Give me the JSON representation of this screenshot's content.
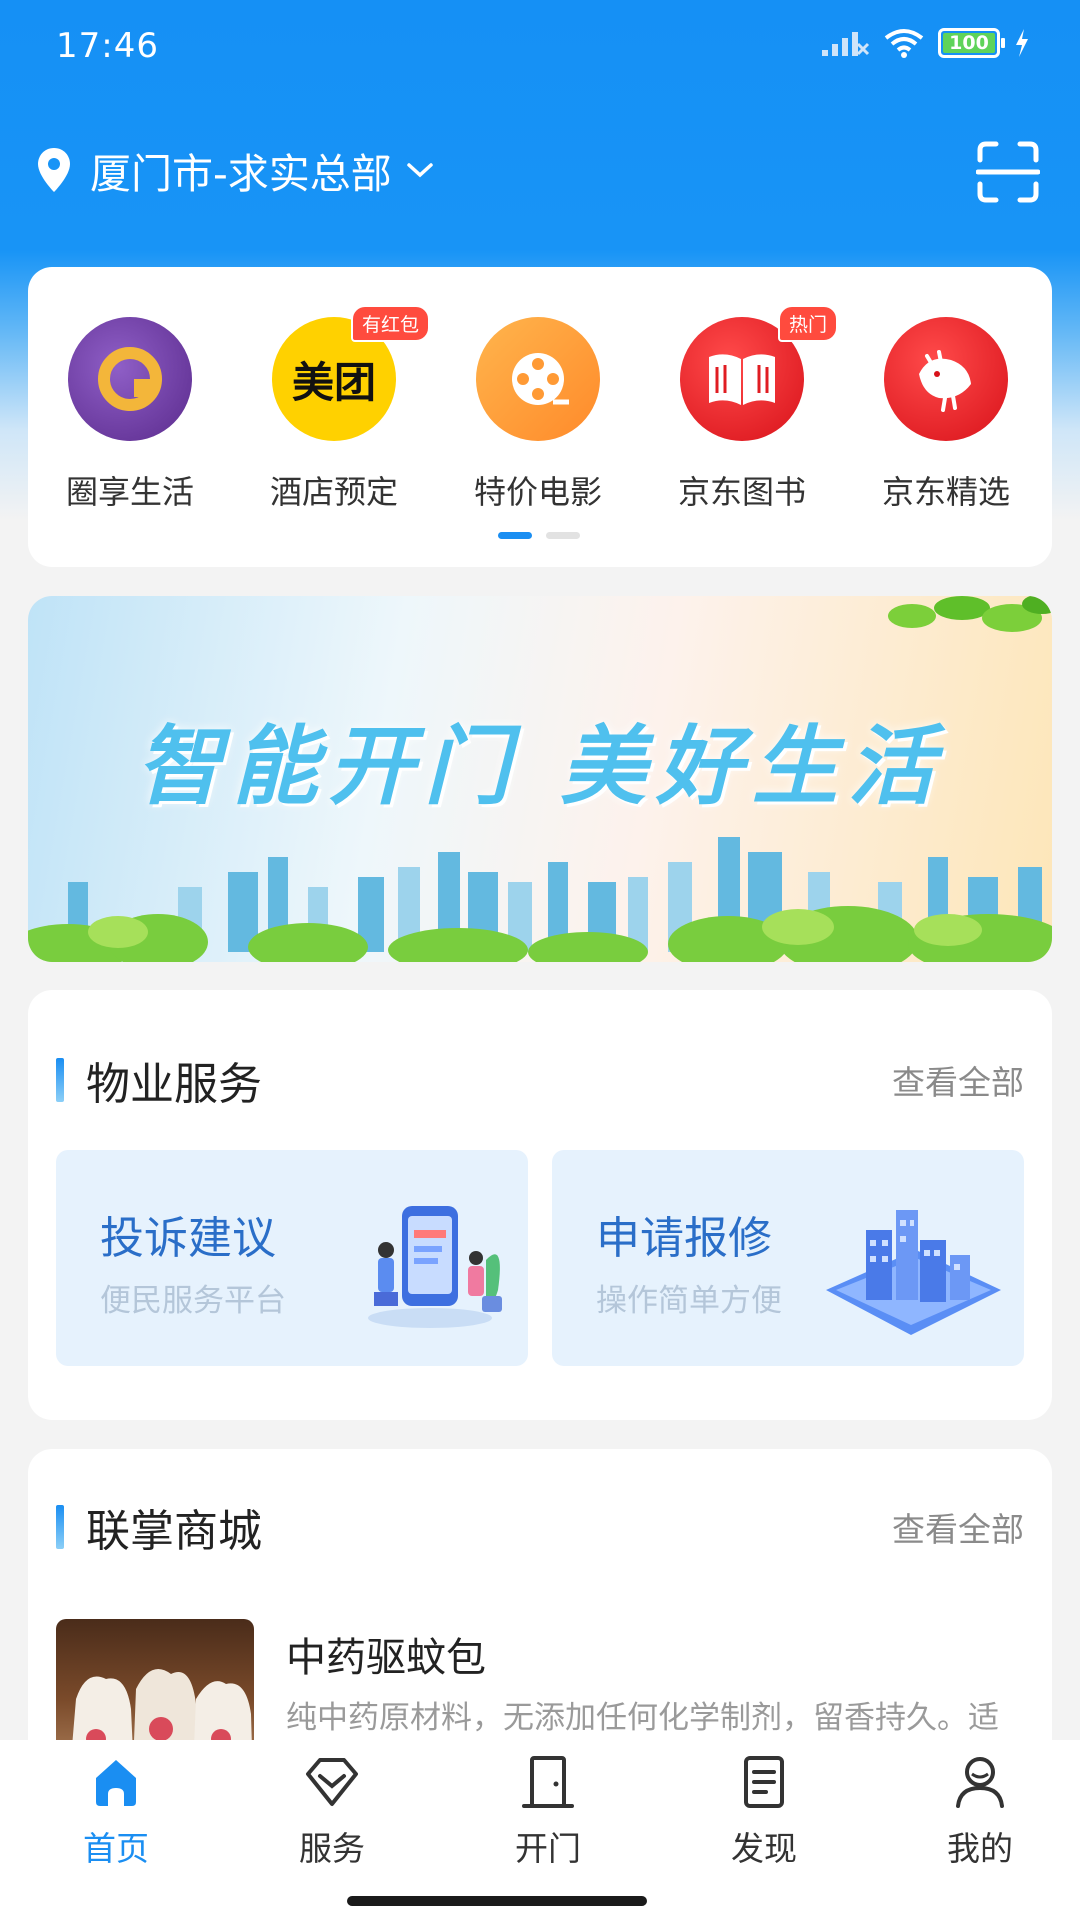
{
  "status_bar": {
    "time": "17:46",
    "battery": "100"
  },
  "location": {
    "label": "厦门市-求实总部"
  },
  "shortcuts": {
    "items": [
      {
        "label": "圈享生活",
        "icon": "circle-life-icon",
        "badge": ""
      },
      {
        "label": "酒店预定",
        "icon": "meituan-icon",
        "badge": "有红包"
      },
      {
        "label": "特价电影",
        "icon": "film-reel-icon",
        "badge": ""
      },
      {
        "label": "京东图书",
        "icon": "book-icon",
        "badge": "热门"
      },
      {
        "label": "京东精选",
        "icon": "jd-dog-icon",
        "badge": ""
      }
    ],
    "meituan_text": "美团"
  },
  "banner": {
    "title": "智能开门 美好生活"
  },
  "property": {
    "title": "物业服务",
    "more": "查看全部",
    "tiles": [
      {
        "title": "投诉建议",
        "subtitle": "便民服务平台"
      },
      {
        "title": "申请报修",
        "subtitle": "操作简单方便"
      }
    ]
  },
  "mall": {
    "title": "联掌商城",
    "more": "查看全部",
    "product": {
      "name": "中药驱蚊包",
      "description": "纯中药原材料，无添加任何化学制剂，留香持久。适用于宝宝房间,卧室,车内,办公室等场所"
    }
  },
  "tabs": [
    {
      "label": "首页",
      "icon": "home-icon",
      "active": true
    },
    {
      "label": "服务",
      "icon": "diamond-icon",
      "active": false
    },
    {
      "label": "开门",
      "icon": "door-icon",
      "active": false
    },
    {
      "label": "发现",
      "icon": "document-icon",
      "active": false
    },
    {
      "label": "我的",
      "icon": "user-icon",
      "active": false
    }
  ],
  "colors": {
    "primary": "#1a8ef2",
    "header": "#1590f5",
    "badge": "#ff4b3e"
  }
}
